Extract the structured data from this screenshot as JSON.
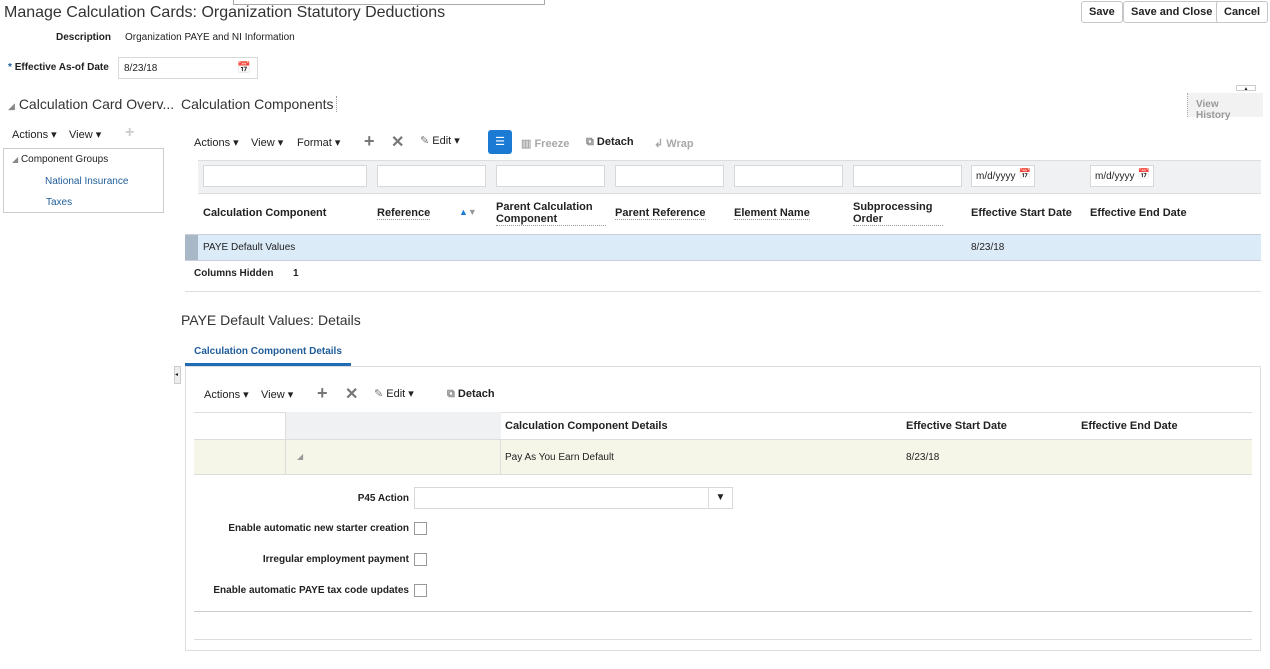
{
  "header": {
    "title": "Manage Calculation Cards: Organization Statutory Deductions",
    "save": "Save",
    "save_close": "Save and Close",
    "cancel": "Cancel"
  },
  "description": {
    "label": "Description",
    "value": "Organization PAYE and NI Information"
  },
  "effective_date": {
    "required": "*",
    "label": "Effective As-of Date",
    "value": "8/23/18"
  },
  "overview": {
    "title": "Calculation Card Overv...",
    "actions": "Actions",
    "view": "View",
    "root": "Component Groups",
    "items": [
      "National Insurance",
      "Taxes"
    ]
  },
  "components": {
    "title": "Calculation Components",
    "view_history": "View History",
    "toolbar": {
      "actions": "Actions",
      "view": "View",
      "format": "Format",
      "edit": "Edit",
      "freeze": "Freeze",
      "detach": "Detach",
      "wrap": "Wrap"
    },
    "date_placeholder": "m/d/yyyy",
    "columns": [
      "Calculation Component",
      "Reference",
      "Parent Calculation Component",
      "Parent Reference",
      "Element Name",
      "Subprocessing Order",
      "Effective Start Date",
      "Effective End Date"
    ],
    "rows": [
      {
        "component": "PAYE Default Values",
        "start": "8/23/18",
        "end": ""
      }
    ],
    "columns_hidden_label": "Columns Hidden",
    "columns_hidden": "1"
  },
  "details": {
    "title": "PAYE Default Values: Details",
    "tab": "Calculation Component Details",
    "toolbar": {
      "actions": "Actions",
      "view": "View",
      "edit": "Edit",
      "detach": "Detach"
    },
    "columns": [
      "Calculation Component Details",
      "Effective Start Date",
      "Effective End Date"
    ],
    "rows": [
      {
        "name": "Pay As You Earn Default",
        "start": "8/23/18",
        "end": ""
      }
    ],
    "fields": {
      "p45": "P45 Action",
      "p45_value": "",
      "starter": "Enable automatic new starter creation",
      "irregular": "Irregular employment payment",
      "tax_code": "Enable automatic PAYE tax code updates"
    }
  },
  "colors": {
    "accent": "#1f5c99",
    "selected_row": "#dcebf8",
    "detail_row": "#f6f6e8",
    "filter_bar": "#f0f1f2"
  }
}
